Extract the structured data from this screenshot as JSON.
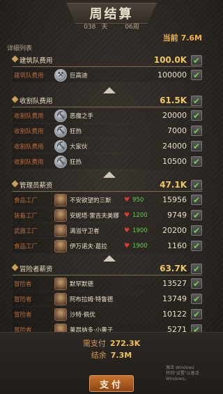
{
  "title": "周结算",
  "date": {
    "day_num": "038",
    "day_unit": "天",
    "week": "06周"
  },
  "current": {
    "label": "当前",
    "value": "7.6M"
  },
  "detail_label": "详细列表",
  "sections": [
    {
      "title": "建筑队费用",
      "amount": "100.0K",
      "rows": [
        {
          "label": "建筑队费用",
          "name": "巨高迪",
          "value": "100000",
          "icon": "hammer-icon"
        }
      ]
    },
    {
      "title": "收割队费用",
      "amount": "61.5K",
      "rows": [
        {
          "label": "收割队费用",
          "name": "恶魔之手",
          "value": "20000",
          "icon": "shovel-icon"
        },
        {
          "label": "收割队费用",
          "name": "狂热",
          "value": "7000",
          "icon": "shovel-icon"
        },
        {
          "label": "收割队费用",
          "name": "大家伙",
          "value": "24000",
          "icon": "shovel-icon"
        },
        {
          "label": "收割队费用",
          "name": "狂热",
          "value": "10500",
          "icon": "shovel-icon"
        }
      ]
    },
    {
      "title": "管理员薪资",
      "amount": "47.1K",
      "rows": [
        {
          "label": "食品工厂",
          "name": "不安欲望的三斯",
          "morale": "950",
          "value": "15956",
          "icon": "character-portrait"
        },
        {
          "label": "装备工厂",
          "name": "安妮塔·雷吉夫美娜",
          "morale": "1200",
          "value": "9749",
          "icon": "character-portrait"
        },
        {
          "label": "武器工厂",
          "name": "满溢守卫者",
          "morale": "1900",
          "value": "20200",
          "icon": "character-portrait"
        },
        {
          "label": "食品工厂",
          "name": "伊万诺夫·葛拉",
          "morale": "1900",
          "value": "1160",
          "icon": "character-portrait"
        }
      ]
    },
    {
      "title": "冒险者薪资",
      "amount": "63.7K",
      "rows": [
        {
          "label": "冒险者",
          "name": "默罕默德",
          "value": "13527",
          "icon": "character-portrait"
        },
        {
          "label": "冒险者",
          "name": "阿布拉姆·特鲁德",
          "value": "13749",
          "icon": "character-portrait"
        },
        {
          "label": "冒险者",
          "name": "沙特·佩优",
          "value": "10122",
          "icon": "character-portrait"
        },
        {
          "label": "冒险者",
          "name": "莱昂纳多·小黄子",
          "value": "5271",
          "icon": "character-portrait"
        }
      ]
    }
  ],
  "footer": {
    "total_pay_label": "需支付",
    "total_pay_value": "272.3K",
    "balance_label": "结余",
    "balance_value": "7.3M",
    "pay_button": "支付"
  },
  "watermark": {
    "line1": "激活 Windows",
    "line2": "转到\"设置\"以激活 Windows。"
  },
  "colors": {
    "accent": "#f0c860",
    "check": "#6ed44a",
    "heart": "#e03838"
  }
}
